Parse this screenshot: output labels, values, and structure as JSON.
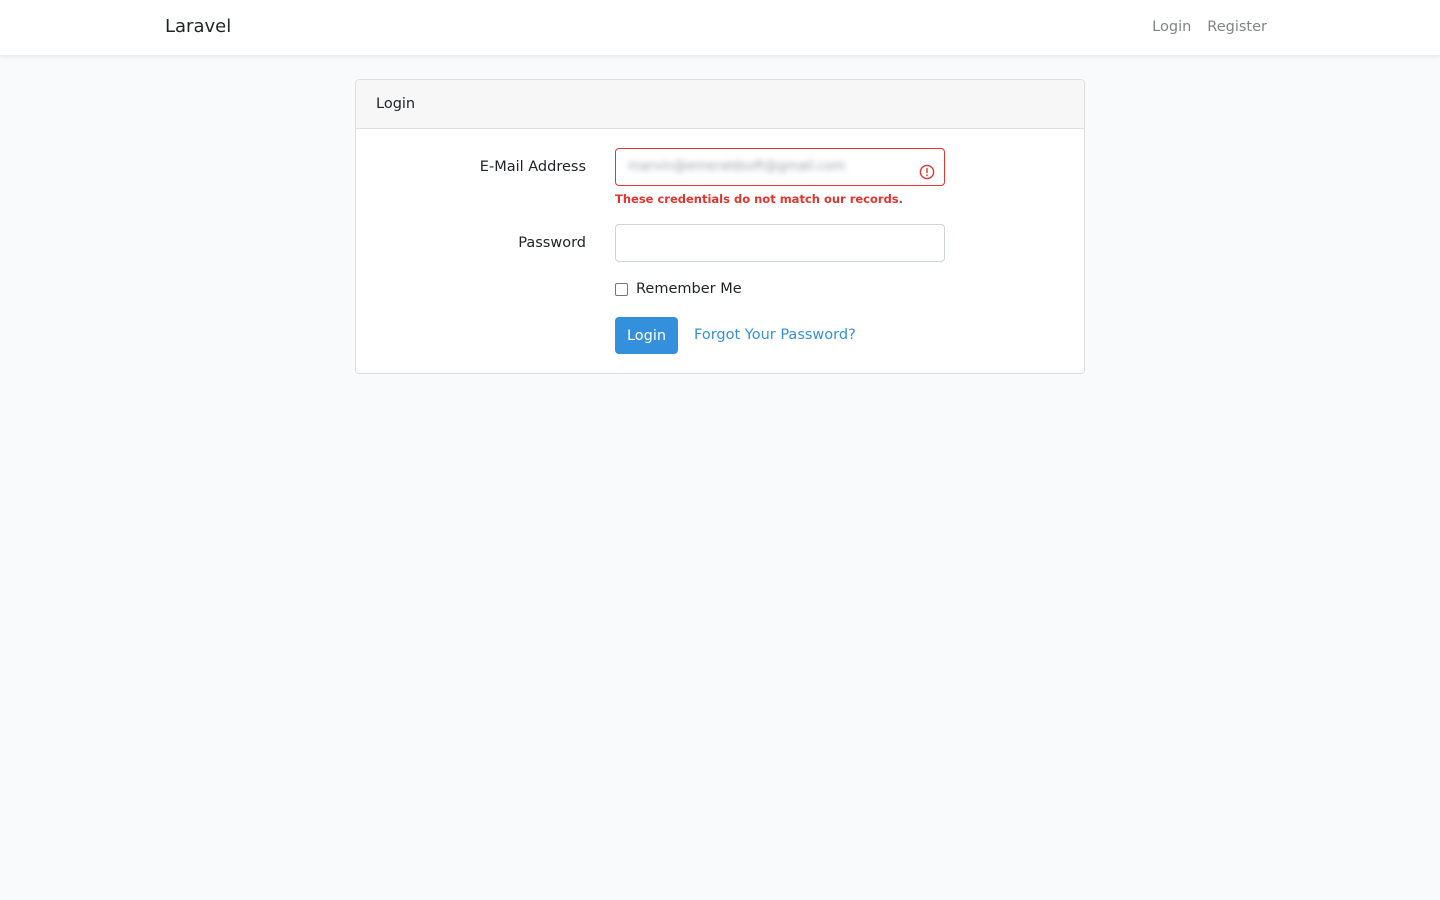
{
  "navbar": {
    "brand": "Laravel",
    "links": [
      {
        "label": "Login"
      },
      {
        "label": "Register"
      }
    ]
  },
  "login_card": {
    "header": "Login",
    "email": {
      "label": "E-Mail Address",
      "value": "marvin@emeraldsoft@gmail.com",
      "error": "These credentials do not match our records."
    },
    "password": {
      "label": "Password",
      "value": ""
    },
    "remember": {
      "label": "Remember Me",
      "checked": false
    },
    "submit_label": "Login",
    "forgot_label": "Forgot Your Password?"
  },
  "colors": {
    "primary": "#3490dc",
    "danger": "#e3342f",
    "background": "#f8fafc"
  },
  "icons": {
    "invalid": "exclamation-circle-icon"
  }
}
